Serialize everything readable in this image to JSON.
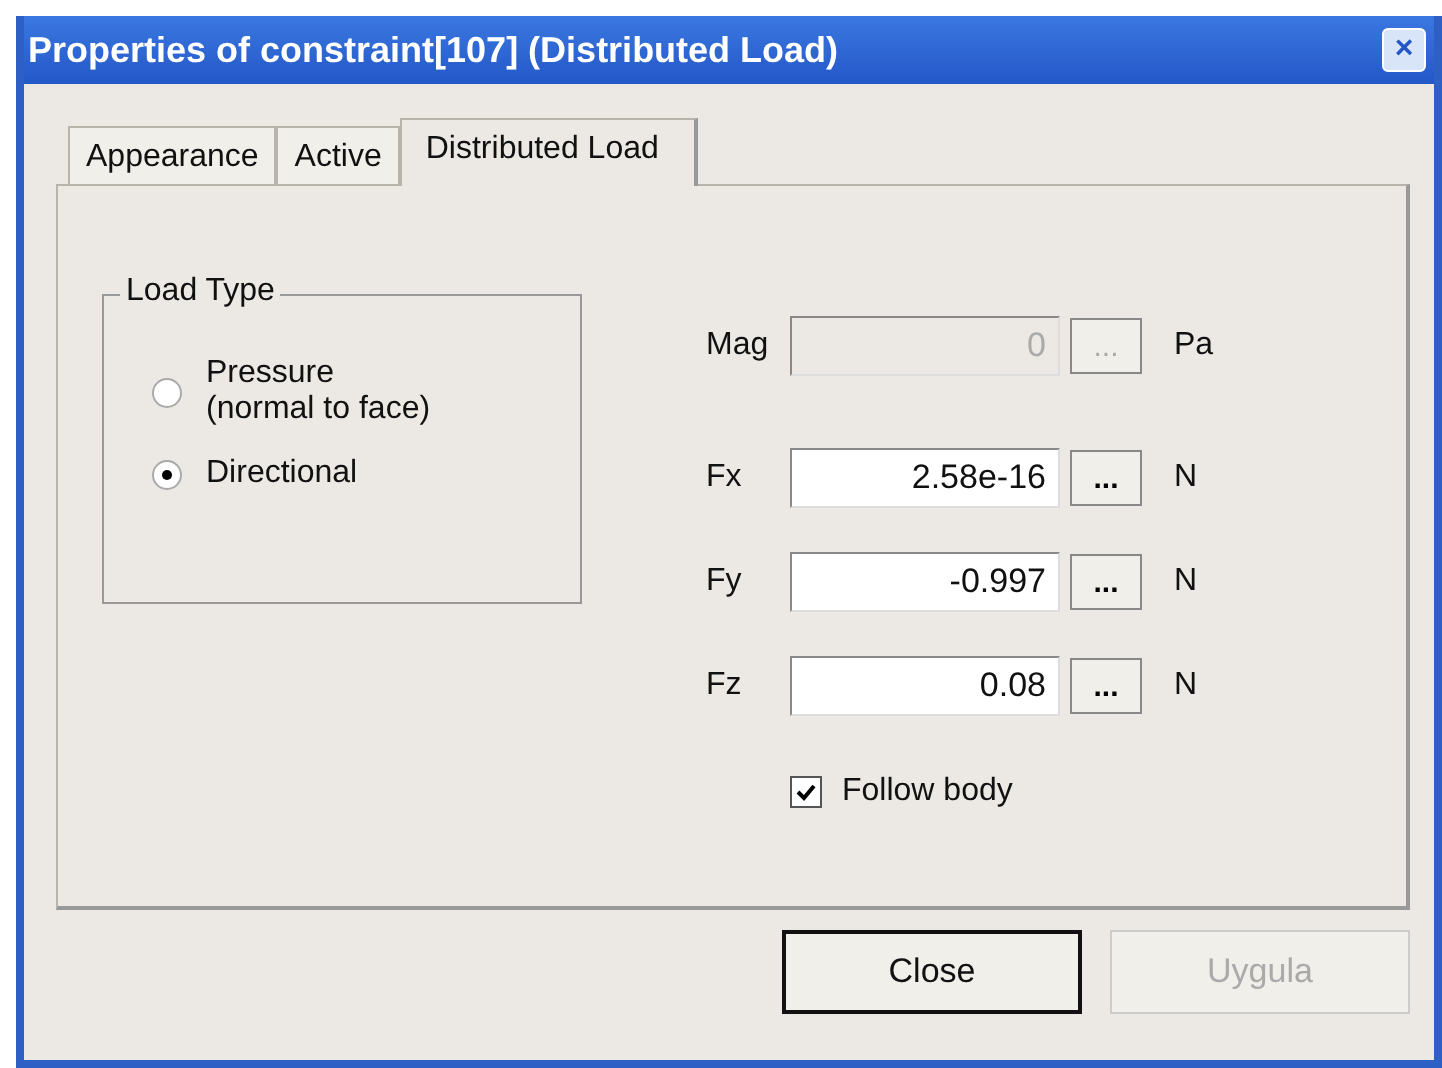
{
  "window": {
    "title": "Properties of constraint[107] (Distributed Load)",
    "close": "×"
  },
  "tabs": [
    {
      "label": "Appearance",
      "selected": false
    },
    {
      "label": "Active",
      "selected": false
    },
    {
      "label": "Distributed Load",
      "selected": true
    }
  ],
  "load_type": {
    "title": "Load Type",
    "options": [
      {
        "label": "Pressure\n(normal to face)",
        "selected": false
      },
      {
        "label": "Directional",
        "selected": true
      }
    ]
  },
  "fields": [
    {
      "label": "Mag",
      "value": "0",
      "button": "...",
      "unit": "Pa",
      "disabled": true
    },
    {
      "label": "Fx",
      "value": "2.58e-16",
      "button": "...",
      "unit": "N",
      "disabled": false
    },
    {
      "label": "Fy",
      "value": "-0.997",
      "button": "...",
      "unit": "N",
      "disabled": false
    },
    {
      "label": "Fz",
      "value": "0.08",
      "button": "...",
      "unit": "N",
      "disabled": false
    }
  ],
  "follow_body": {
    "label": "Follow body",
    "checked": true
  },
  "buttons": [
    {
      "label": "Close",
      "disabled": false,
      "default": true
    },
    {
      "label": "Uygula",
      "disabled": true,
      "default": false
    }
  ]
}
